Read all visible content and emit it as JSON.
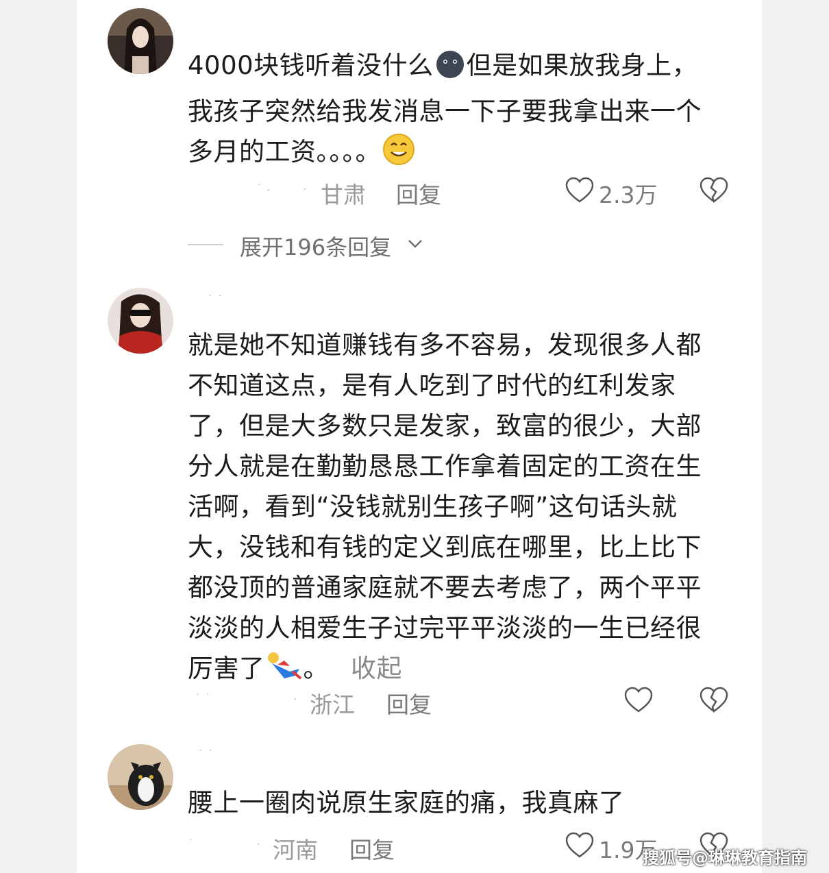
{
  "comments": [
    {
      "text_part1": "4000块钱听着没什么",
      "text_part2": "但是如果放我身上，",
      "text_line2": "我孩子突然给我发消息一下子要我拿出来一个",
      "text_line3": "多月的工资。。。。",
      "location": "甘肃",
      "reply_label": "回复",
      "likes": "2.3万",
      "expand_label": "展开196条回复"
    },
    {
      "lines": [
        "就是她不知道赚钱有多不容易，发现很多人都",
        "不知道这点，是有人吃到了时代的红利发家",
        "了，但是大多数只是发家，致富的很少，大部",
        "分人就是在勤勤恳恳工作拿着固定的工资在生",
        "活啊，看到“没钱就别生孩子啊”这句话头就",
        "大，没钱和有钱的定义到底在哪里，比上比下",
        "都没顶的普通家庭就不要去考虑了，两个平平",
        "淡淡的人相爱生子过完平平淡淡的一生已经很"
      ],
      "last_line": "厉害了",
      "last_punct": "。",
      "collapse_label": "收起",
      "location": "浙江",
      "reply_label": "回复"
    },
    {
      "text": "腰上一圈肉说原生家庭的痛，我真麻了",
      "location": "河南",
      "reply_label": "回复",
      "likes": "1.9万"
    }
  ],
  "watermark": "搜狐号@琳琳教育指南",
  "colors": {
    "text": "#1b1b1b",
    "meta": "#9a9a9a",
    "background": "#ffffff"
  }
}
